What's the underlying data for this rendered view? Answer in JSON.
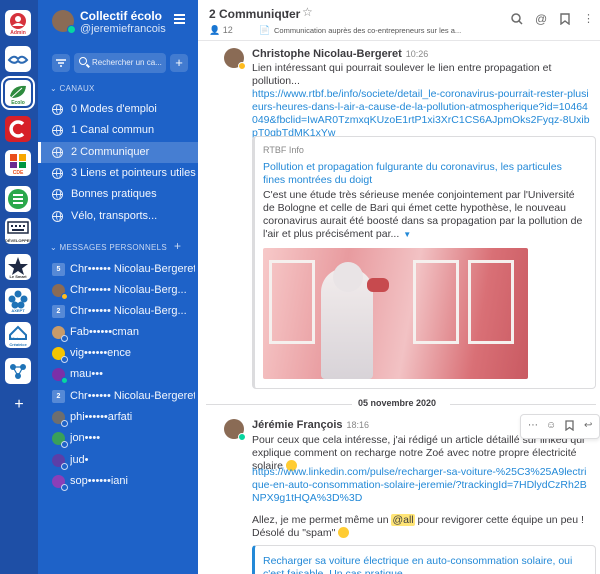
{
  "teams": [
    {
      "name": "Admin",
      "icon": "admin-logo-icon",
      "bg": "#ffffff",
      "fg": "#d6323c"
    },
    {
      "name": "",
      "icon": "handshake-logo-icon",
      "bg": "#ffffff",
      "fg": "#2c6ab3"
    },
    {
      "name": "Ecolo",
      "icon": "ecolo-logo-icon",
      "bg": "#ffffff",
      "fg": "#2e8b3e"
    },
    {
      "name": "C",
      "icon": "c-logo-icon",
      "bg": "#d72028",
      "fg": "#ffffff"
    },
    {
      "name": "CDE",
      "icon": "puzzle-logo-icon",
      "bg": "#ffffff",
      "fg": "#e94e1b"
    },
    {
      "name": "e",
      "icon": "e-logo-icon",
      "bg": "#ffffff",
      "fg": "#2aa84a"
    },
    {
      "name": "DÉVELOPPEMENT",
      "icon": "keyboard-logo-icon",
      "bg": "#ffffff",
      "fg": "#1f2a44"
    },
    {
      "name": "Le Smart",
      "icon": "star-logo-icon",
      "bg": "#ffffff",
      "fg": "#1f2a44"
    },
    {
      "name": "AXEPT",
      "icon": "flower-logo-icon",
      "bg": "#ffffff",
      "fg": "#1f73b7"
    },
    {
      "name": "Maison Créatrice",
      "icon": "house-logo-icon",
      "bg": "#ffffff",
      "fg": "#1f73b7"
    },
    {
      "name": "",
      "icon": "network-logo-icon",
      "bg": "#ffffff",
      "fg": "#1f73b7"
    }
  ],
  "rail_add": "+",
  "sidebar": {
    "team_name": "Collectif écolo",
    "username": "@jeremiefrancois",
    "search_placeholder": "Rechercher un ca...",
    "add_label": "+",
    "channels_header": "CANAUX",
    "channels": [
      {
        "label": "0 Modes d'emploi",
        "active": false
      },
      {
        "label": "1 Canal commun",
        "active": false
      },
      {
        "label": "2 Communiquer",
        "active": true
      },
      {
        "label": "3 Liens et pointeurs utiles",
        "active": false
      },
      {
        "label": "Bonnes pratiques",
        "active": false
      },
      {
        "label": "Vélo, transports...",
        "active": false
      }
    ],
    "dm_header": "MESSAGES PERSONNELS",
    "dm_add": "+",
    "dms": [
      {
        "badge": "5",
        "label": "Chr•••••• Nicolau-Bergeret",
        "status": "none"
      },
      {
        "badge": "",
        "label": "Chr•••••• Nicolau-Berg...",
        "status": "away"
      },
      {
        "badge": "2",
        "label": "Chr•••••• Nicolau-Berg...",
        "status": "none"
      },
      {
        "badge": "",
        "label": "Fab••••••cman",
        "status": "off"
      },
      {
        "badge": "",
        "label": "vig••••••ence",
        "status": "off"
      },
      {
        "badge": "",
        "label": "mau•••",
        "status": "online"
      },
      {
        "badge": "2",
        "label": "Chr•••••• Nicolau-Bergeret",
        "status": "none"
      },
      {
        "badge": "",
        "label": "phi••••••arfati",
        "status": "off"
      },
      {
        "badge": "",
        "label": "jon••••",
        "status": "off"
      },
      {
        "badge": "",
        "label": "jud•",
        "status": "off"
      },
      {
        "badge": "",
        "label": "sop••••••iani",
        "status": "off"
      }
    ]
  },
  "channel": {
    "name": "2 Communiquer",
    "members": "12",
    "purpose": "Communication auprès des co-entrepreneurs sur les a..."
  },
  "posts": [
    {
      "author": "Christophe Nicolau-Bergeret",
      "time": "10:26",
      "text": "Lien intéressant qui pourrait soulever le lien entre propagation et pollution...",
      "link": "https://www.rtbf.be/info/societe/detail_le-coronavirus-pourrait-rester-plusieurs-heures-dans-l-air-a-cause-de-la-pollution-atmospherique?id=10464049&fbclid=IwAR0TzmxqKUzoE1rtP1xi3XrC1CS6AJpmOks2Fyqz-8UxibpT0gbTdMK1xYw",
      "embed": {
        "site": "RTBF Info",
        "title": "Pollution et propagation fulgurante du coronavirus, les particules fines montrées du doigt",
        "description": "C'est une étude très sérieuse menée conjointement par l'Université de Bologne et celle de Bari qui émet cette hypothèse, le nouveau coronavirus aurait été boosté dans sa propagation par la pollution de l'air et plus précisément par..."
      }
    },
    {
      "author": "Jérémie François",
      "time": "18:16",
      "text": "Pour ceux que cela intéresse, j'ai rédigé un article détaillé sur linked qui explique comment on recharge notre Zoé avec notre propre électricité solaire",
      "link": "https://www.linkedin.com/pulse/recharger-sa-voiture-%25C3%25A9lectrique-en-auto-consommation-solaire-jeremie/?trackingId=7HDlydCzRh2BNPX9g1tHQA%3D%3D",
      "text2_before": "Allez, je me permet même un ",
      "mention": "@all",
      "text2_after": " pour revigorer cette équipe un peu !  Désolé du \"spam\"",
      "embed_title": "Recharger sa voiture électrique en auto-consommation solaire, oui c'est faisable. Un cas pratique"
    }
  ],
  "date_separator": "05 novembre 2020",
  "colors": {
    "accent": "#1e62c8",
    "link": "#2389d7",
    "rail": "#1e4fa6"
  }
}
